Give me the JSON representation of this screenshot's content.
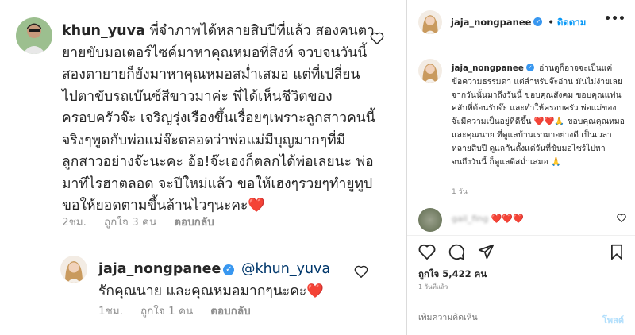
{
  "left_comment": {
    "username": "khun_yuva",
    "text": "พี่จำภาพได้หลายสิบปีที่แล้ว สองคนตายายขับมอเตอร์ไซค์มาหาคุณหมอที่สิงห์ จวบจนวันนี้สองตายายก็ยังมาหาคุณหมอสม่ำเสมอ แต่ที่เปลี่ยนไปตาขับรถเบ๊นซ์สีขาวมาค่ะ พี่ได้เห็นชีวิตของครอบครัวจ๊ะ เจริญรุ่งเรืองขึ้นเรื่อยๆเพราะลูกสาวคนนี้จริงๆพูดกับพ่อแม่จ๊ะตลอดว่าพ่อแม่มีบุญมากๆที่มีลูกสาวอย่างจ๊ะนะคะ อ้อ!จ๊ะเองก็ตลกได้พ่อเลยนะ พ่อมาทีไรฮาตลอด จะปีใหม่แล้ว ขอให้เฮงๆรวยๆทำยูทูปขอให้ยอดตามขึ้นล้านไวๆนะคะ",
    "emoji": "❤️",
    "time": "2ชม.",
    "likes": "ถูกใจ 3 คน",
    "reply": "ตอบกลับ"
  },
  "left_reply": {
    "username": "jaja_nongpanee",
    "mention": "@khun_yuva",
    "text": "รักคุณนาย และคุณหมอมากๆนะคะ",
    "emoji": "❤️",
    "time": "1ชม.",
    "likes": "ถูกใจ 1 คน",
    "reply": "ตอบกลับ"
  },
  "header": {
    "username": "jaja_nongpanee",
    "separator": "•",
    "follow": "ติดตาม",
    "more": "•••"
  },
  "caption": {
    "username": "jaja_nongpanee",
    "text": "อ่านดูก็อาจจะเป็นแค่ข้อความธรรมดา แต่สำหรับจ๊ะอ่าน มันไม่ง่ายเลย จากวันนั้นมาถึงวันนี้ ขอบคุณสังคม ขอบคุณแฟนคลับที่ต้อนรับจ๊ะ และทำให้ครอบครัว พ่อแม่ของจ๊ะมีความเป็นอยู่ที่ดีขึ้น",
    "emojis": "❤️❤️🙏",
    "text2": "ขอบคุณคุณหมอและคุณนาย ที่ดูแลบ้านเรามาอย่างดี เป็นเวลาหลายสิบปี ดูแลกันตั้งแต่วันที่ขับมอไซร์ไปหา จนถึงวันนี้ ก็ดูแลดีสม่ำเสมอ",
    "emoji_end": "🙏",
    "time": "1 วัน"
  },
  "comment3": {
    "username": "gail_fing",
    "hearts": "❤️❤️❤️"
  },
  "actions": {
    "likes": "ถูกใจ 5,422 คน",
    "ago": "1 วันที่แล้ว"
  },
  "add_comment": {
    "placeholder": "เพิ่มความคิดเห็น",
    "post": "โพสต์"
  },
  "colors": {
    "link_blue": "#0095f6",
    "verified_blue": "#3897f0",
    "heart_red": "#e0245e",
    "muted": "#8e8e8e"
  }
}
